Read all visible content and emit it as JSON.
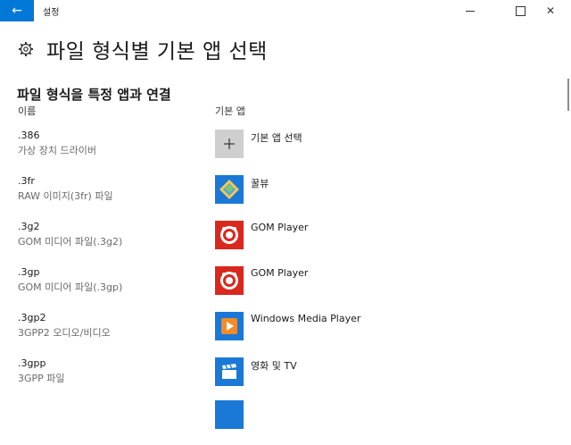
{
  "window": {
    "title": "설정"
  },
  "page": {
    "title": "파일 형식별 기본 앱 선택"
  },
  "section": {
    "title": "파일 형식을 특정 앱과 연결",
    "col_name": "이름",
    "col_app": "기본 앱"
  },
  "rows": [
    {
      "ext": ".386",
      "desc": "가상 장치 드라이버",
      "app": "기본 앱 선택",
      "icon": "plus-icon"
    },
    {
      "ext": ".3fr",
      "desc": "RAW 이미지(3fr) 파일",
      "app": "꿀뷰",
      "icon": "honeyview-icon"
    },
    {
      "ext": ".3g2",
      "desc": "GOM 미디어 파일(.3g2)",
      "app": "GOM Player",
      "icon": "gom-player-icon"
    },
    {
      "ext": ".3gp",
      "desc": "GOM 미디어 파일(.3gp)",
      "app": "GOM Player",
      "icon": "gom-player-icon"
    },
    {
      "ext": ".3gp2",
      "desc": "3GPP2 오디오/비디오",
      "app": "Windows Media Player",
      "icon": "windows-media-player-icon"
    },
    {
      "ext": ".3gpp",
      "desc": "3GPP 파일",
      "app": "영화 및 TV",
      "icon": "movies-tv-icon"
    }
  ],
  "colors": {
    "accent": "#0078d7",
    "gom": "#d9281d",
    "app_tile": "#1a78d6",
    "placeholder_tile": "#cfcfcf"
  }
}
